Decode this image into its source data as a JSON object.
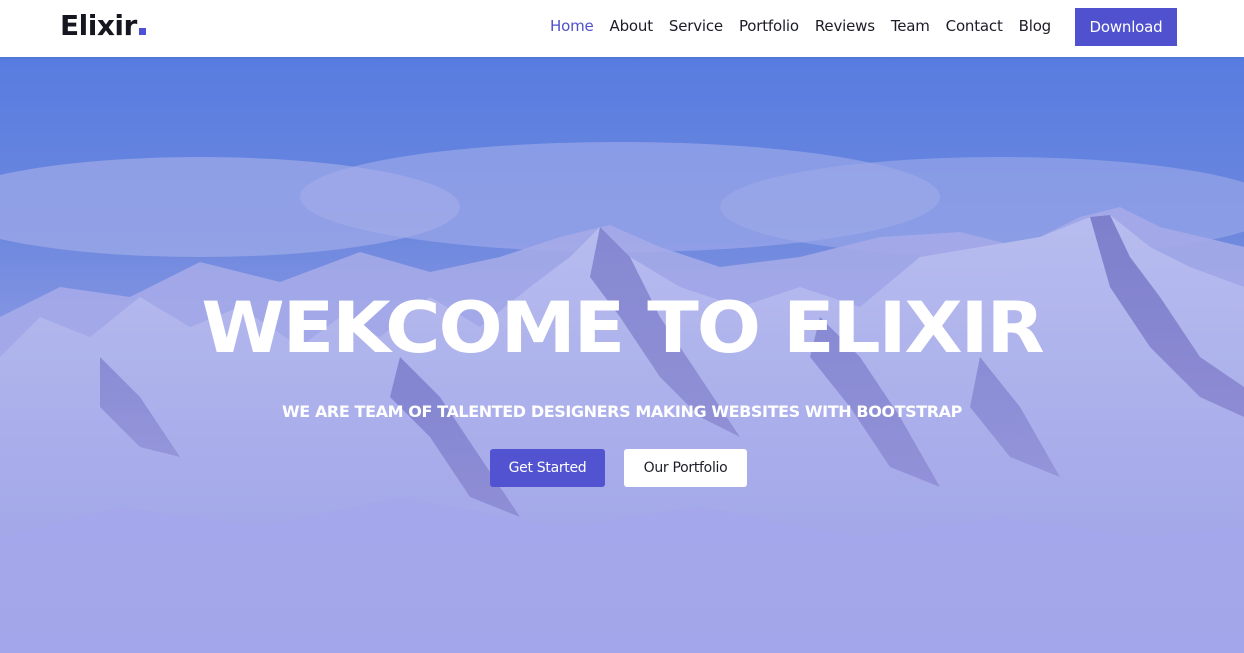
{
  "brand": {
    "logo_text": "Elixir",
    "accent_color": "#4f51d4"
  },
  "nav": {
    "items": [
      {
        "label": "Home",
        "active": true
      },
      {
        "label": "About",
        "active": false
      },
      {
        "label": "Service",
        "active": false
      },
      {
        "label": "Portfolio",
        "active": false
      },
      {
        "label": "Reviews",
        "active": false
      },
      {
        "label": "Team",
        "active": false
      },
      {
        "label": "Contact",
        "active": false
      },
      {
        "label": "Blog",
        "active": false
      }
    ],
    "download_label": "Download"
  },
  "hero": {
    "title": "WEKCOME TO ELIXIR",
    "subtitle": "WE ARE TEAM OF TALENTED DESIGNERS MAKING WEBSITES WITH BOOTSTRAP",
    "primary_button": "Get Started",
    "secondary_button": "Our Portfolio"
  }
}
